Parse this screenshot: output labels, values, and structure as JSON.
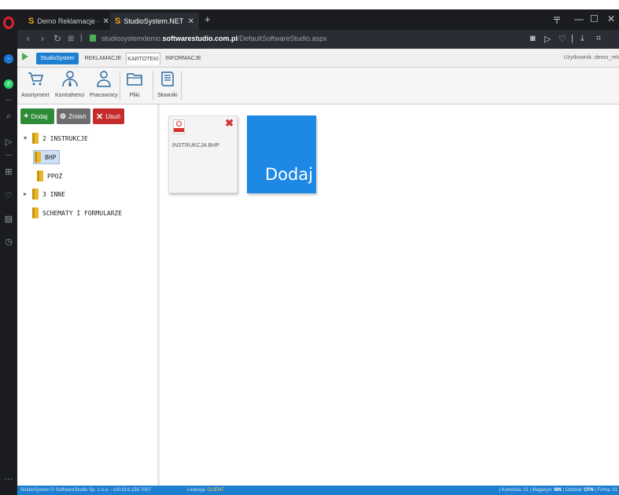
{
  "browser": {
    "tabs": [
      {
        "title": "Demo Reklamacje - Demo",
        "favicon": "S"
      },
      {
        "title": "StudioSystem.NET (c) Softw",
        "favicon": "S"
      }
    ],
    "url_path_pre": "studiosystemdemo.",
    "url_domain": "softwarestudio.com.pl",
    "url_path_post": "/DefaultSoftwareStudio.aspx"
  },
  "menu": {
    "brand": "StudioSystem",
    "tabs": [
      "REKLAMACJE",
      "KARTOTEKI",
      "INFORMACJE"
    ],
    "user": "Użytkownik: demo_rek"
  },
  "ribbon": {
    "items": [
      {
        "label": "Asortyment"
      },
      {
        "label": "Kontrahenci"
      },
      {
        "label": "Pracownicy"
      },
      {
        "label": "Pliki"
      },
      {
        "label": "Słowniki"
      }
    ]
  },
  "toolbar": {
    "add": "Dodaj",
    "edit": "Zmień",
    "delete": "Usuń"
  },
  "tree": {
    "nodes": [
      {
        "label": "2 INSTRUKCJE",
        "expanded": true
      },
      {
        "label": "BHP",
        "selected": true
      },
      {
        "label": "PPOŻ"
      },
      {
        "label": "3 INNE",
        "expanded": false
      },
      {
        "label": "SCHEMATY I FORMULARZE"
      }
    ]
  },
  "content": {
    "file_name": "INSTRUKCJA BHP",
    "add_tile": "Dodaj"
  },
  "status": {
    "left": "StudioSystem © SoftwareStudio Sp. z o.o. - v2019.6.158.7097",
    "license_label": "Licencja:",
    "license_value": "CLIENT",
    "right_pre": "| Komórka: 01 | Magazyn:",
    "magazyn": "MN",
    "right_mid": "| Oddział:",
    "oddzial": "CFN",
    "right_post": "| Firma: 01"
  },
  "colors": {
    "brand_blue": "#1e7fd0",
    "add_green": "#2e8b38",
    "delete_red": "#c52b2b",
    "tile_blue": "#1e88e5"
  }
}
